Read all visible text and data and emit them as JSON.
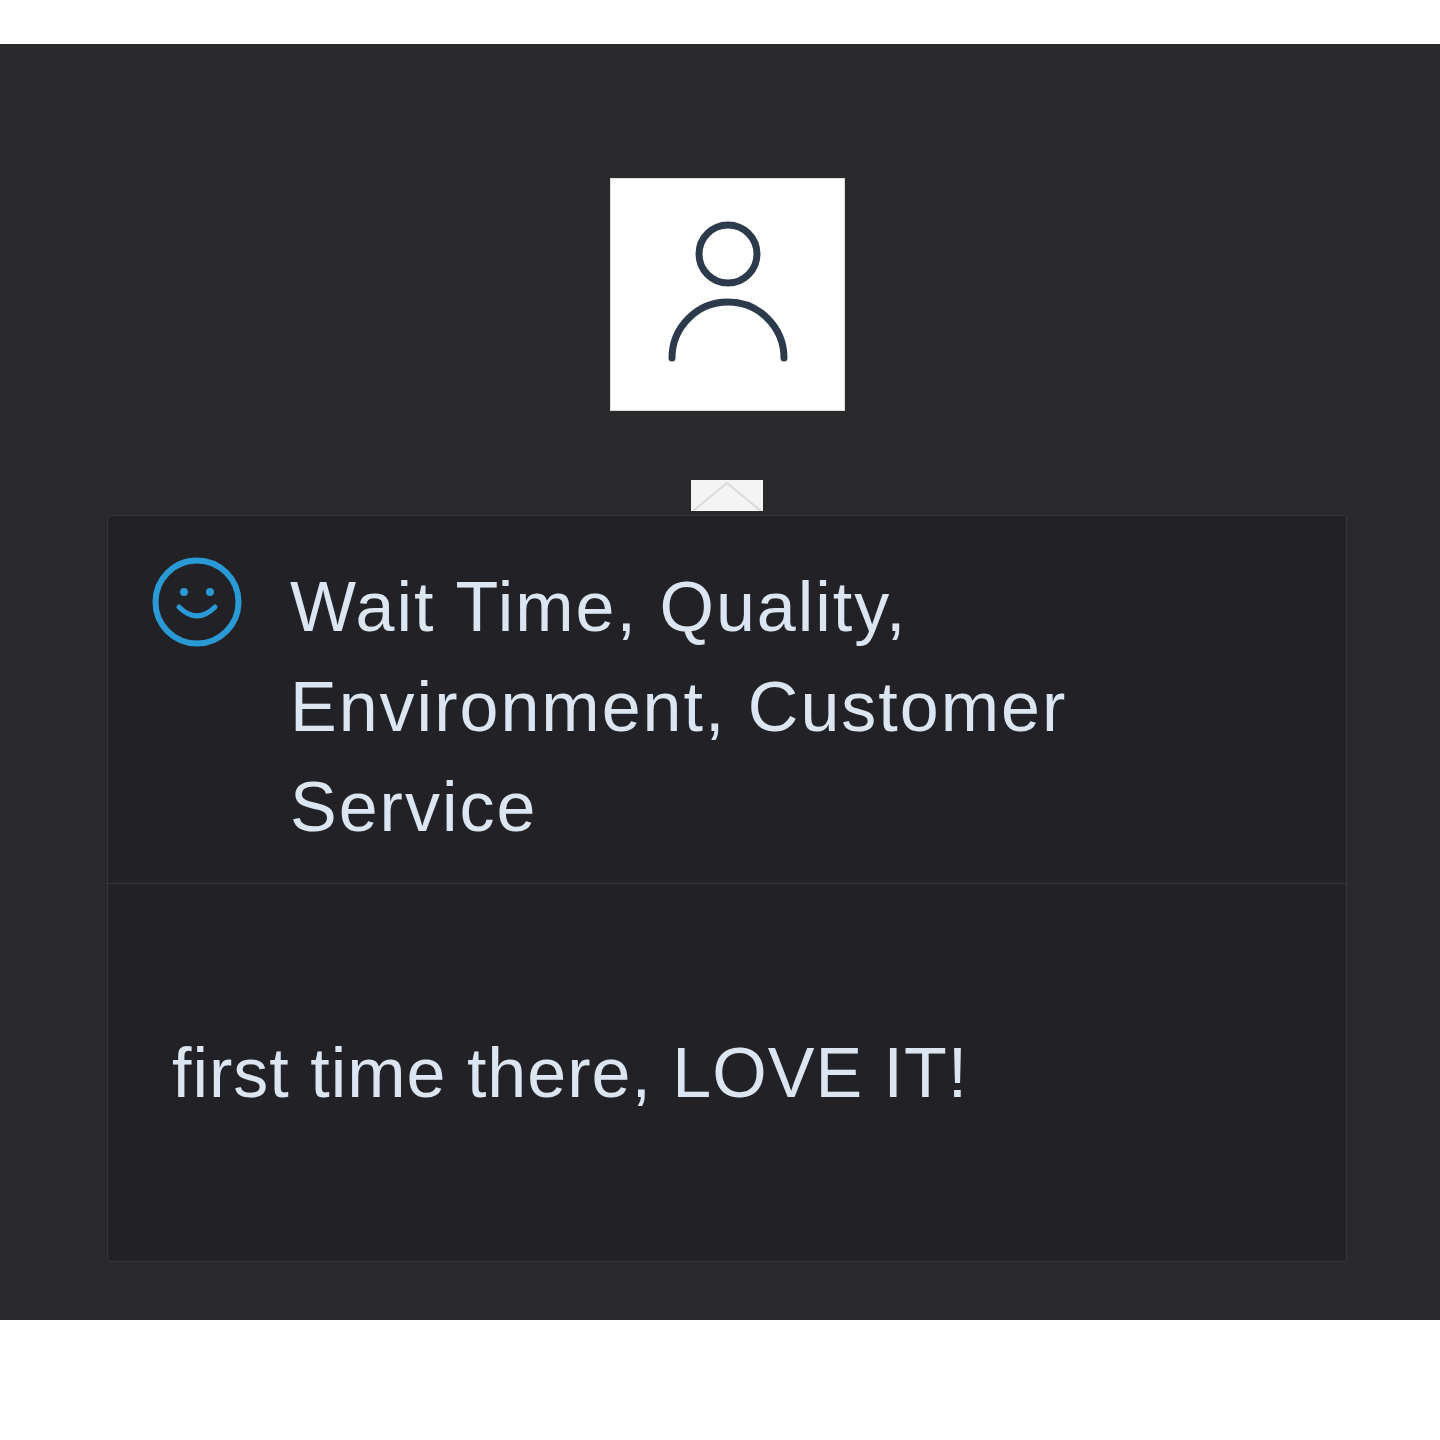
{
  "review": {
    "positive": true,
    "title": "Wait Time, Quality, Environment, Customer Service",
    "comment": "first time there, LOVE IT!"
  }
}
